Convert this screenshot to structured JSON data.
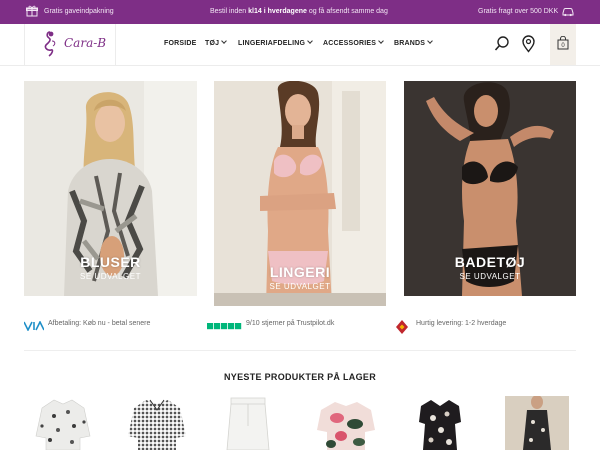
{
  "topbar": {
    "left_text": "Gratis gaveindpakning",
    "middle_prefix": "Bestil inden ",
    "middle_bold": "kl14 i hverdagene",
    "middle_suffix": " og få afsendt samme dag",
    "right_text": "Gratis fragt over 500 DKK",
    "bg_color": "#7e2e86"
  },
  "header": {
    "logo_text": "Cara-B",
    "nav": [
      {
        "label": "FORSIDE"
      },
      {
        "label": "TØJ"
      },
      {
        "label": "LINGERIAFDELING"
      },
      {
        "label": "ACCESSORIES"
      },
      {
        "label": "BRANDS"
      }
    ],
    "cart_count": "0",
    "icons": [
      "search-icon",
      "location-pin-icon",
      "shopping-bag-icon"
    ]
  },
  "tiles": [
    {
      "title": "BLUSER",
      "subtitle": "SE UDVALGET"
    },
    {
      "title": "LINGERI",
      "subtitle": "SE UDVALGET"
    },
    {
      "title": "BADETØJ",
      "subtitle": "SE UDVALGET"
    }
  ],
  "trust": {
    "payment": "Afbetaling: Køb nu - betal senere",
    "trustpilot": "9/10 stjerner på Trustpilot.dk",
    "delivery": "Hurtig levering: 1-2 hverdage",
    "trustpilot_color": "#00b67a"
  },
  "products_section": {
    "title": "NYESTE PRODUKTER PÅ LAGER",
    "products": [
      {
        "name": "floral-shirt"
      },
      {
        "name": "gingham-shirt"
      },
      {
        "name": "white-denim-skirt"
      },
      {
        "name": "tropical-top"
      },
      {
        "name": "floral-dress"
      },
      {
        "name": "model-dress"
      }
    ]
  }
}
